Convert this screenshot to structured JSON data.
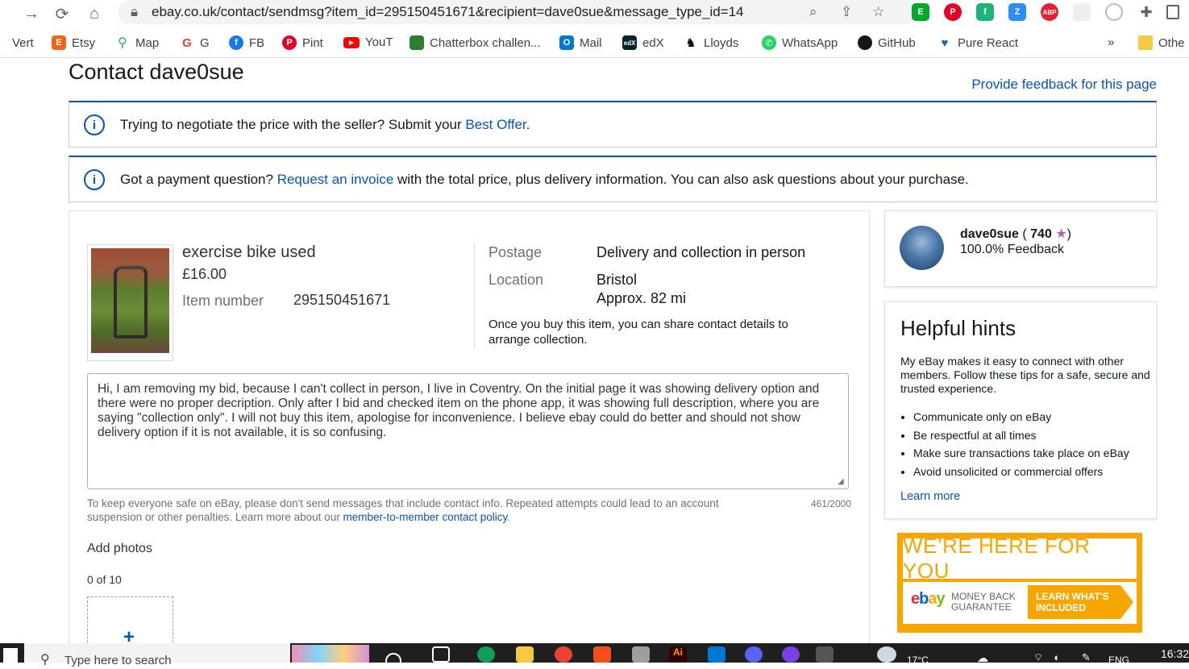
{
  "browser": {
    "url": "ebay.co.uk/contact/sendmsg?item_id=295150451671&recipient=dave0sue&message_type_id=14",
    "bookmarks": [
      {
        "label": "Vert",
        "icon": "vert-icon",
        "color": "#4285f4"
      },
      {
        "label": "Etsy",
        "icon": "etsy-icon",
        "color": "#f1641e"
      },
      {
        "label": "Map",
        "icon": "map-pin-icon",
        "color": "#34a853"
      },
      {
        "label": "G",
        "icon": "google-icon",
        "color": "#ea4335"
      },
      {
        "label": "FB",
        "icon": "facebook-icon",
        "color": "#1877f2"
      },
      {
        "label": "Pint",
        "icon": "pinterest-icon",
        "color": "#e60023"
      },
      {
        "label": "YouT",
        "icon": "youtube-icon",
        "color": "#ff0000"
      },
      {
        "label": "Chatterbox challen...",
        "icon": "chatterbox-icon",
        "color": "#2e7d32"
      },
      {
        "label": "Mail",
        "icon": "outlook-icon",
        "color": "#0078d4"
      },
      {
        "label": "edX",
        "icon": "edx-icon",
        "color": "#02262b"
      },
      {
        "label": "Lloyds",
        "icon": "lloyds-horse-icon",
        "color": "#000000"
      },
      {
        "label": "WhatsApp",
        "icon": "whatsapp-icon",
        "color": "#25d366"
      },
      {
        "label": "GitHub",
        "icon": "github-icon",
        "color": "#181717"
      },
      {
        "label": "Pure React",
        "icon": "heart-icon",
        "color": "#1565c0"
      }
    ],
    "overflow": "»",
    "other_bookmarks": "Othe"
  },
  "page": {
    "title": "Contact dave0sue",
    "feedback_link": "Provide feedback for this page"
  },
  "banners": [
    {
      "before": "Trying to negotiate the price with the seller? Submit your ",
      "link": "Best Offer",
      "after": "."
    },
    {
      "before": "Got a payment question? ",
      "link": "Request an invoice",
      "after": " with the total price, plus delivery information. You can also ask questions about your purchase."
    }
  ],
  "item": {
    "title": "exercise bike used",
    "price": "£16.00",
    "number_label": "Item number",
    "number": "295150451671",
    "postage_label": "Postage",
    "postage": "Delivery and collection in person",
    "location_label": "Location",
    "location": "Bristol",
    "distance": "Approx. 82 mi",
    "collection_note": "Once you buy this item, you can share contact details to arrange collection."
  },
  "message": {
    "text": "Hi, I am removing my bid, because I can't collect in person, I live in Coventry. On the initial page it was showing delivery option and there were no proper decription.  Only after I bid and checked item on the phone app, it was showing full description, where you are saying \"collection only\". I will not buy this item, apologise for inconvenience. I believe ebay could do better and should not show delivery option if it is not available, it is so confusing.",
    "counter": "461/2000",
    "safety_before": "To keep everyone safe on eBay, please don't send messages that include contact info. Repeated attempts could lead to an account suspension or other penalties. Learn more about our ",
    "safety_link": "member-to-member contact policy",
    "safety_after": "."
  },
  "photos": {
    "label": "Add photos",
    "count": "0 of 10",
    "add_symbol": "+"
  },
  "seller": {
    "name": "dave0sue",
    "paren_open": " ( ",
    "score": "740",
    "star": "★",
    "paren_close": ")",
    "feedback": "100.0% Feedback"
  },
  "hints": {
    "title": "Helpful hints",
    "intro": "My eBay makes it easy to connect with other members. Follow these tips for a safe, secure and trusted experience.",
    "items": [
      "Communicate only on eBay",
      "Be respectful at all times",
      "Make sure transactions take place on eBay",
      "Avoid unsolicited or commercial offers"
    ],
    "learn_more": "Learn more"
  },
  "mbg": {
    "headline": "WE’RE HERE FOR YOU",
    "guarantee_line1": "MONEY BACK",
    "guarantee_line2": "GUARANTEE",
    "cta_line1": "LEARN WHAT'S",
    "cta_line2": "INCLUDED"
  },
  "taskbar": {
    "search_placeholder": "Type here to search",
    "temperature": "17°C",
    "language": "ENG",
    "time": "16:32"
  },
  "colors": {
    "link": "#0654ba",
    "accent": "#0654ba",
    "mbg_orange": "#f7a600",
    "star": "#b25bb1"
  }
}
